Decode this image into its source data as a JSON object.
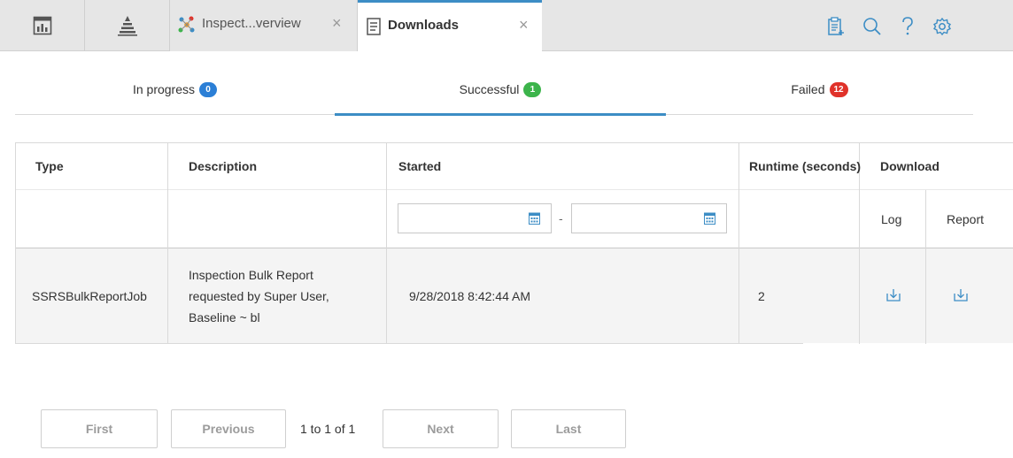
{
  "topbar": {
    "tabs": [
      {
        "label": "Inspect...verview",
        "icon": "network-icon"
      },
      {
        "label": "Downloads",
        "icon": "document-icon"
      }
    ],
    "close_glyph": "×"
  },
  "status_tabs": [
    {
      "label": "In progress",
      "count": "0",
      "color": "#2b7fd6"
    },
    {
      "label": "Successful",
      "count": "1",
      "color": "#3cb44b"
    },
    {
      "label": "Failed",
      "count": "12",
      "color": "#e0322a"
    }
  ],
  "table": {
    "headers": {
      "type": "Type",
      "description": "Description",
      "started": "Started",
      "runtime": "Runtime (seconds)",
      "download": "Download",
      "log": "Log",
      "report": "Report"
    },
    "date_separator": "-",
    "rows": [
      {
        "type": "SSRSBulkReportJob",
        "description": [
          "Inspection Bulk Report",
          "requested by Super User,",
          "Baseline ~ bl"
        ],
        "started": "9/28/2018 8:42:44 AM",
        "runtime": "2"
      }
    ]
  },
  "pager": {
    "first": "First",
    "previous": "Previous",
    "info": "1 to 1 of 1",
    "next": "Next",
    "last": "Last"
  },
  "colors": {
    "accent": "#3c8dc5"
  }
}
